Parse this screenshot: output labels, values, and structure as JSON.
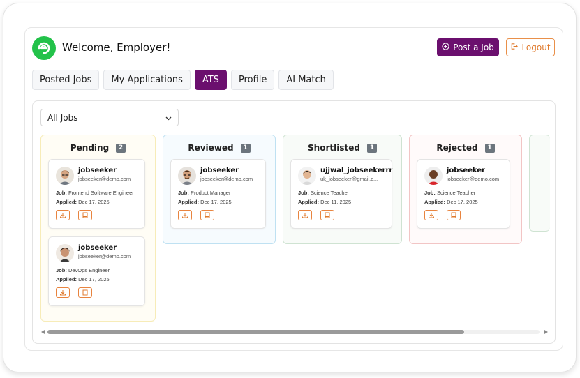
{
  "header": {
    "welcome": "Welcome, Employer!",
    "post_job_label": "Post a Job",
    "logout_label": "Logout"
  },
  "tabs": [
    {
      "label": "Posted Jobs",
      "active": false
    },
    {
      "label": "My Applications",
      "active": false
    },
    {
      "label": "ATS",
      "active": true
    },
    {
      "label": "Profile",
      "active": false
    },
    {
      "label": "AI Match",
      "active": false
    }
  ],
  "filter": {
    "selected": "All Jobs"
  },
  "labels": {
    "job": "Job:",
    "applied": "Applied:"
  },
  "columns": [
    {
      "title": "Pending",
      "count": "2",
      "cards": [
        {
          "name": "jobseeker",
          "email": "jobseeker@demo.com",
          "job": "Frontend Software Engineer",
          "applied": "Dec 17, 2025"
        },
        {
          "name": "jobseeker",
          "email": "jobseeker@demo.com",
          "job": "DevOps Engineer",
          "applied": "Dec 17, 2025"
        }
      ]
    },
    {
      "title": "Reviewed",
      "count": "1",
      "cards": [
        {
          "name": "jobseeker",
          "email": "jobseeker@demo.com",
          "job": "Product Manager",
          "applied": "Dec 17, 2025"
        }
      ]
    },
    {
      "title": "Shortlisted",
      "count": "1",
      "cards": [
        {
          "name": "ujjwal_jobseekerrr",
          "email": "uk_jobseeker@gmail.c...",
          "job": "Science Teacher",
          "applied": "Dec 11, 2025"
        }
      ]
    },
    {
      "title": "Rejected",
      "count": "1",
      "cards": [
        {
          "name": "jobseeker",
          "email": "jobseeker@demo.com",
          "job": "Science Teacher",
          "applied": "Dec 17, 2025"
        }
      ]
    }
  ],
  "colors": {
    "brand_purple": "#6b0f6e",
    "accent_orange": "#e07a2c",
    "logo_green": "#23c24a"
  },
  "icons": {
    "logo": "brand-logo-icon",
    "post_job": "plus-circle-icon",
    "logout": "logout-icon",
    "filter": "chevron-down-icon",
    "download": "download-icon",
    "view": "book-icon"
  }
}
